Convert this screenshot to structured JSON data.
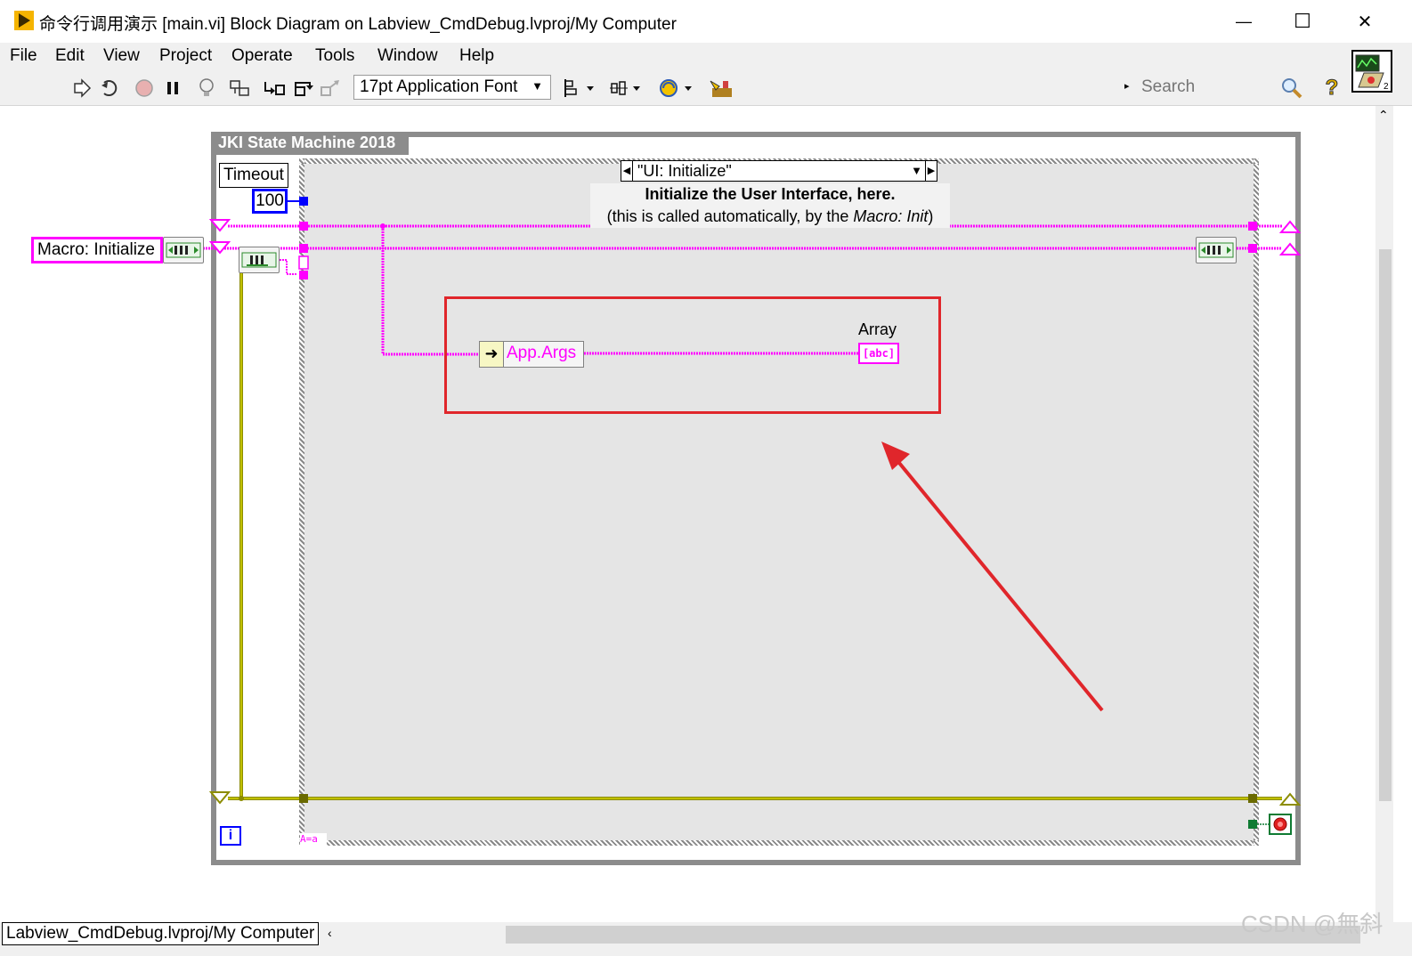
{
  "window": {
    "title": "命令行调用演示 [main.vi] Block Diagram on Labview_CmdDebug.lvproj/My Computer",
    "minimize_symbol": "—",
    "maximize_symbol": "☐",
    "close_symbol": "✕"
  },
  "menu": [
    "File",
    "Edit",
    "View",
    "Project",
    "Operate",
    "Tools",
    "Window",
    "Help"
  ],
  "toolbar": {
    "font_select": "17pt Application Font",
    "search_placeholder": "Search",
    "help_glyph": "?",
    "icons": [
      "run-arrow-icon",
      "run-continuously-icon",
      "abort-icon",
      "pause-icon",
      "highlight-execution-icon",
      "retain-wire-values-icon",
      "step-into-icon",
      "step-over-icon",
      "step-out-icon",
      "align-objects-icon",
      "distribute-objects-icon",
      "reorder-icon",
      "clean-up-diagram-icon"
    ]
  },
  "diagram": {
    "while_loop_label": "JKI State Machine 2018",
    "case_selector": "\"UI: Initialize\"",
    "comment_line1": "Initialize the User Interface, here.",
    "comment_line2_prefix": "(this is called automatically, by the ",
    "comment_line2_italic": "Macro: Init",
    "comment_line2_suffix": ")",
    "timeout_label": "Timeout",
    "timeout_value": "100",
    "macro_constant": "Macro: Initialize",
    "property_node": "App.Args",
    "indicator_label": "Array",
    "indicator_glyph": "[abc]",
    "case_tag": "A=a",
    "iteration_glyph": "i",
    "colors": {
      "string_wire": "#ff00ff",
      "cluster_wire": "#8c8c00",
      "highlight": "#e0262b",
      "frame": "#8c8c8c"
    }
  },
  "status": {
    "path": "Labview_CmdDebug.lvproj/My Computer"
  },
  "watermark": "CSDN @無斜"
}
